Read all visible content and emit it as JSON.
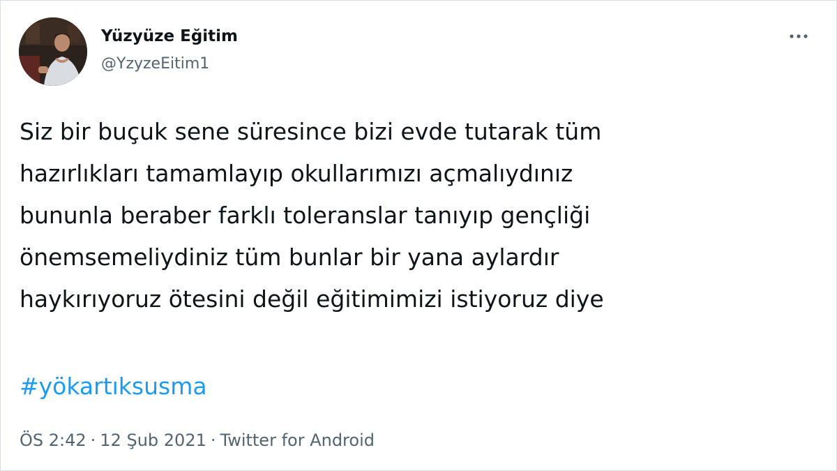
{
  "tweet": {
    "author": {
      "display_name": "Yüzyüze Eğitim",
      "handle": "@YzyzeEitim1",
      "avatar_icon": "profile-photo"
    },
    "more_icon": "ellipsis-icon",
    "text": "Siz bir buçuk sene süresince bizi evde tutarak tüm\nhazırlıkları tamamlayıp okullarımızı açmalıydınız\nbununla beraber farklı toleranslar tanıyıp gençliği\nönemsemeliydiniz tüm bunlar bir yana aylardır\nhaykırıyoruz ötesini değil eğitimimizi istiyoruz diye",
    "hashtag": "#yökartıksusma",
    "time": "ÖS 2:42",
    "date": "12 Şub 2021",
    "separator": "·",
    "source": "Twitter for Android"
  },
  "colors": {
    "text": "#0f1419",
    "secondary": "#536471",
    "link": "#1d9bf0",
    "border": "#d7dde2"
  }
}
